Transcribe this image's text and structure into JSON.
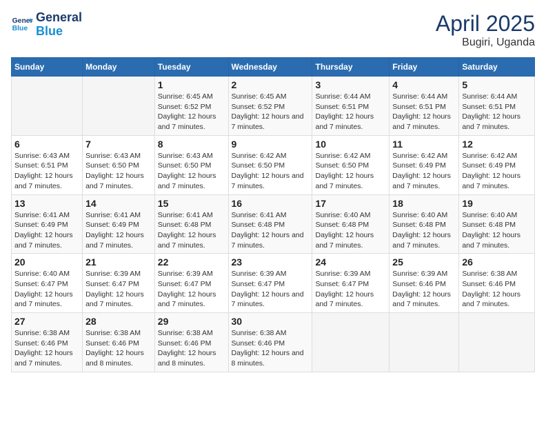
{
  "header": {
    "logo_line1": "General",
    "logo_line2": "Blue",
    "month_year": "April 2025",
    "location": "Bugiri, Uganda"
  },
  "days_of_week": [
    "Sunday",
    "Monday",
    "Tuesday",
    "Wednesday",
    "Thursday",
    "Friday",
    "Saturday"
  ],
  "weeks": [
    [
      {
        "day": "",
        "info": ""
      },
      {
        "day": "",
        "info": ""
      },
      {
        "day": "1",
        "info": "Sunrise: 6:45 AM\nSunset: 6:52 PM\nDaylight: 12 hours and 7 minutes."
      },
      {
        "day": "2",
        "info": "Sunrise: 6:45 AM\nSunset: 6:52 PM\nDaylight: 12 hours and 7 minutes."
      },
      {
        "day": "3",
        "info": "Sunrise: 6:44 AM\nSunset: 6:51 PM\nDaylight: 12 hours and 7 minutes."
      },
      {
        "day": "4",
        "info": "Sunrise: 6:44 AM\nSunset: 6:51 PM\nDaylight: 12 hours and 7 minutes."
      },
      {
        "day": "5",
        "info": "Sunrise: 6:44 AM\nSunset: 6:51 PM\nDaylight: 12 hours and 7 minutes."
      }
    ],
    [
      {
        "day": "6",
        "info": "Sunrise: 6:43 AM\nSunset: 6:51 PM\nDaylight: 12 hours and 7 minutes."
      },
      {
        "day": "7",
        "info": "Sunrise: 6:43 AM\nSunset: 6:50 PM\nDaylight: 12 hours and 7 minutes."
      },
      {
        "day": "8",
        "info": "Sunrise: 6:43 AM\nSunset: 6:50 PM\nDaylight: 12 hours and 7 minutes."
      },
      {
        "day": "9",
        "info": "Sunrise: 6:42 AM\nSunset: 6:50 PM\nDaylight: 12 hours and 7 minutes."
      },
      {
        "day": "10",
        "info": "Sunrise: 6:42 AM\nSunset: 6:50 PM\nDaylight: 12 hours and 7 minutes."
      },
      {
        "day": "11",
        "info": "Sunrise: 6:42 AM\nSunset: 6:49 PM\nDaylight: 12 hours and 7 minutes."
      },
      {
        "day": "12",
        "info": "Sunrise: 6:42 AM\nSunset: 6:49 PM\nDaylight: 12 hours and 7 minutes."
      }
    ],
    [
      {
        "day": "13",
        "info": "Sunrise: 6:41 AM\nSunset: 6:49 PM\nDaylight: 12 hours and 7 minutes."
      },
      {
        "day": "14",
        "info": "Sunrise: 6:41 AM\nSunset: 6:49 PM\nDaylight: 12 hours and 7 minutes."
      },
      {
        "day": "15",
        "info": "Sunrise: 6:41 AM\nSunset: 6:48 PM\nDaylight: 12 hours and 7 minutes."
      },
      {
        "day": "16",
        "info": "Sunrise: 6:41 AM\nSunset: 6:48 PM\nDaylight: 12 hours and 7 minutes."
      },
      {
        "day": "17",
        "info": "Sunrise: 6:40 AM\nSunset: 6:48 PM\nDaylight: 12 hours and 7 minutes."
      },
      {
        "day": "18",
        "info": "Sunrise: 6:40 AM\nSunset: 6:48 PM\nDaylight: 12 hours and 7 minutes."
      },
      {
        "day": "19",
        "info": "Sunrise: 6:40 AM\nSunset: 6:48 PM\nDaylight: 12 hours and 7 minutes."
      }
    ],
    [
      {
        "day": "20",
        "info": "Sunrise: 6:40 AM\nSunset: 6:47 PM\nDaylight: 12 hours and 7 minutes."
      },
      {
        "day": "21",
        "info": "Sunrise: 6:39 AM\nSunset: 6:47 PM\nDaylight: 12 hours and 7 minutes."
      },
      {
        "day": "22",
        "info": "Sunrise: 6:39 AM\nSunset: 6:47 PM\nDaylight: 12 hours and 7 minutes."
      },
      {
        "day": "23",
        "info": "Sunrise: 6:39 AM\nSunset: 6:47 PM\nDaylight: 12 hours and 7 minutes."
      },
      {
        "day": "24",
        "info": "Sunrise: 6:39 AM\nSunset: 6:47 PM\nDaylight: 12 hours and 7 minutes."
      },
      {
        "day": "25",
        "info": "Sunrise: 6:39 AM\nSunset: 6:46 PM\nDaylight: 12 hours and 7 minutes."
      },
      {
        "day": "26",
        "info": "Sunrise: 6:38 AM\nSunset: 6:46 PM\nDaylight: 12 hours and 7 minutes."
      }
    ],
    [
      {
        "day": "27",
        "info": "Sunrise: 6:38 AM\nSunset: 6:46 PM\nDaylight: 12 hours and 7 minutes."
      },
      {
        "day": "28",
        "info": "Sunrise: 6:38 AM\nSunset: 6:46 PM\nDaylight: 12 hours and 8 minutes."
      },
      {
        "day": "29",
        "info": "Sunrise: 6:38 AM\nSunset: 6:46 PM\nDaylight: 12 hours and 8 minutes."
      },
      {
        "day": "30",
        "info": "Sunrise: 6:38 AM\nSunset: 6:46 PM\nDaylight: 12 hours and 8 minutes."
      },
      {
        "day": "",
        "info": ""
      },
      {
        "day": "",
        "info": ""
      },
      {
        "day": "",
        "info": ""
      }
    ]
  ]
}
